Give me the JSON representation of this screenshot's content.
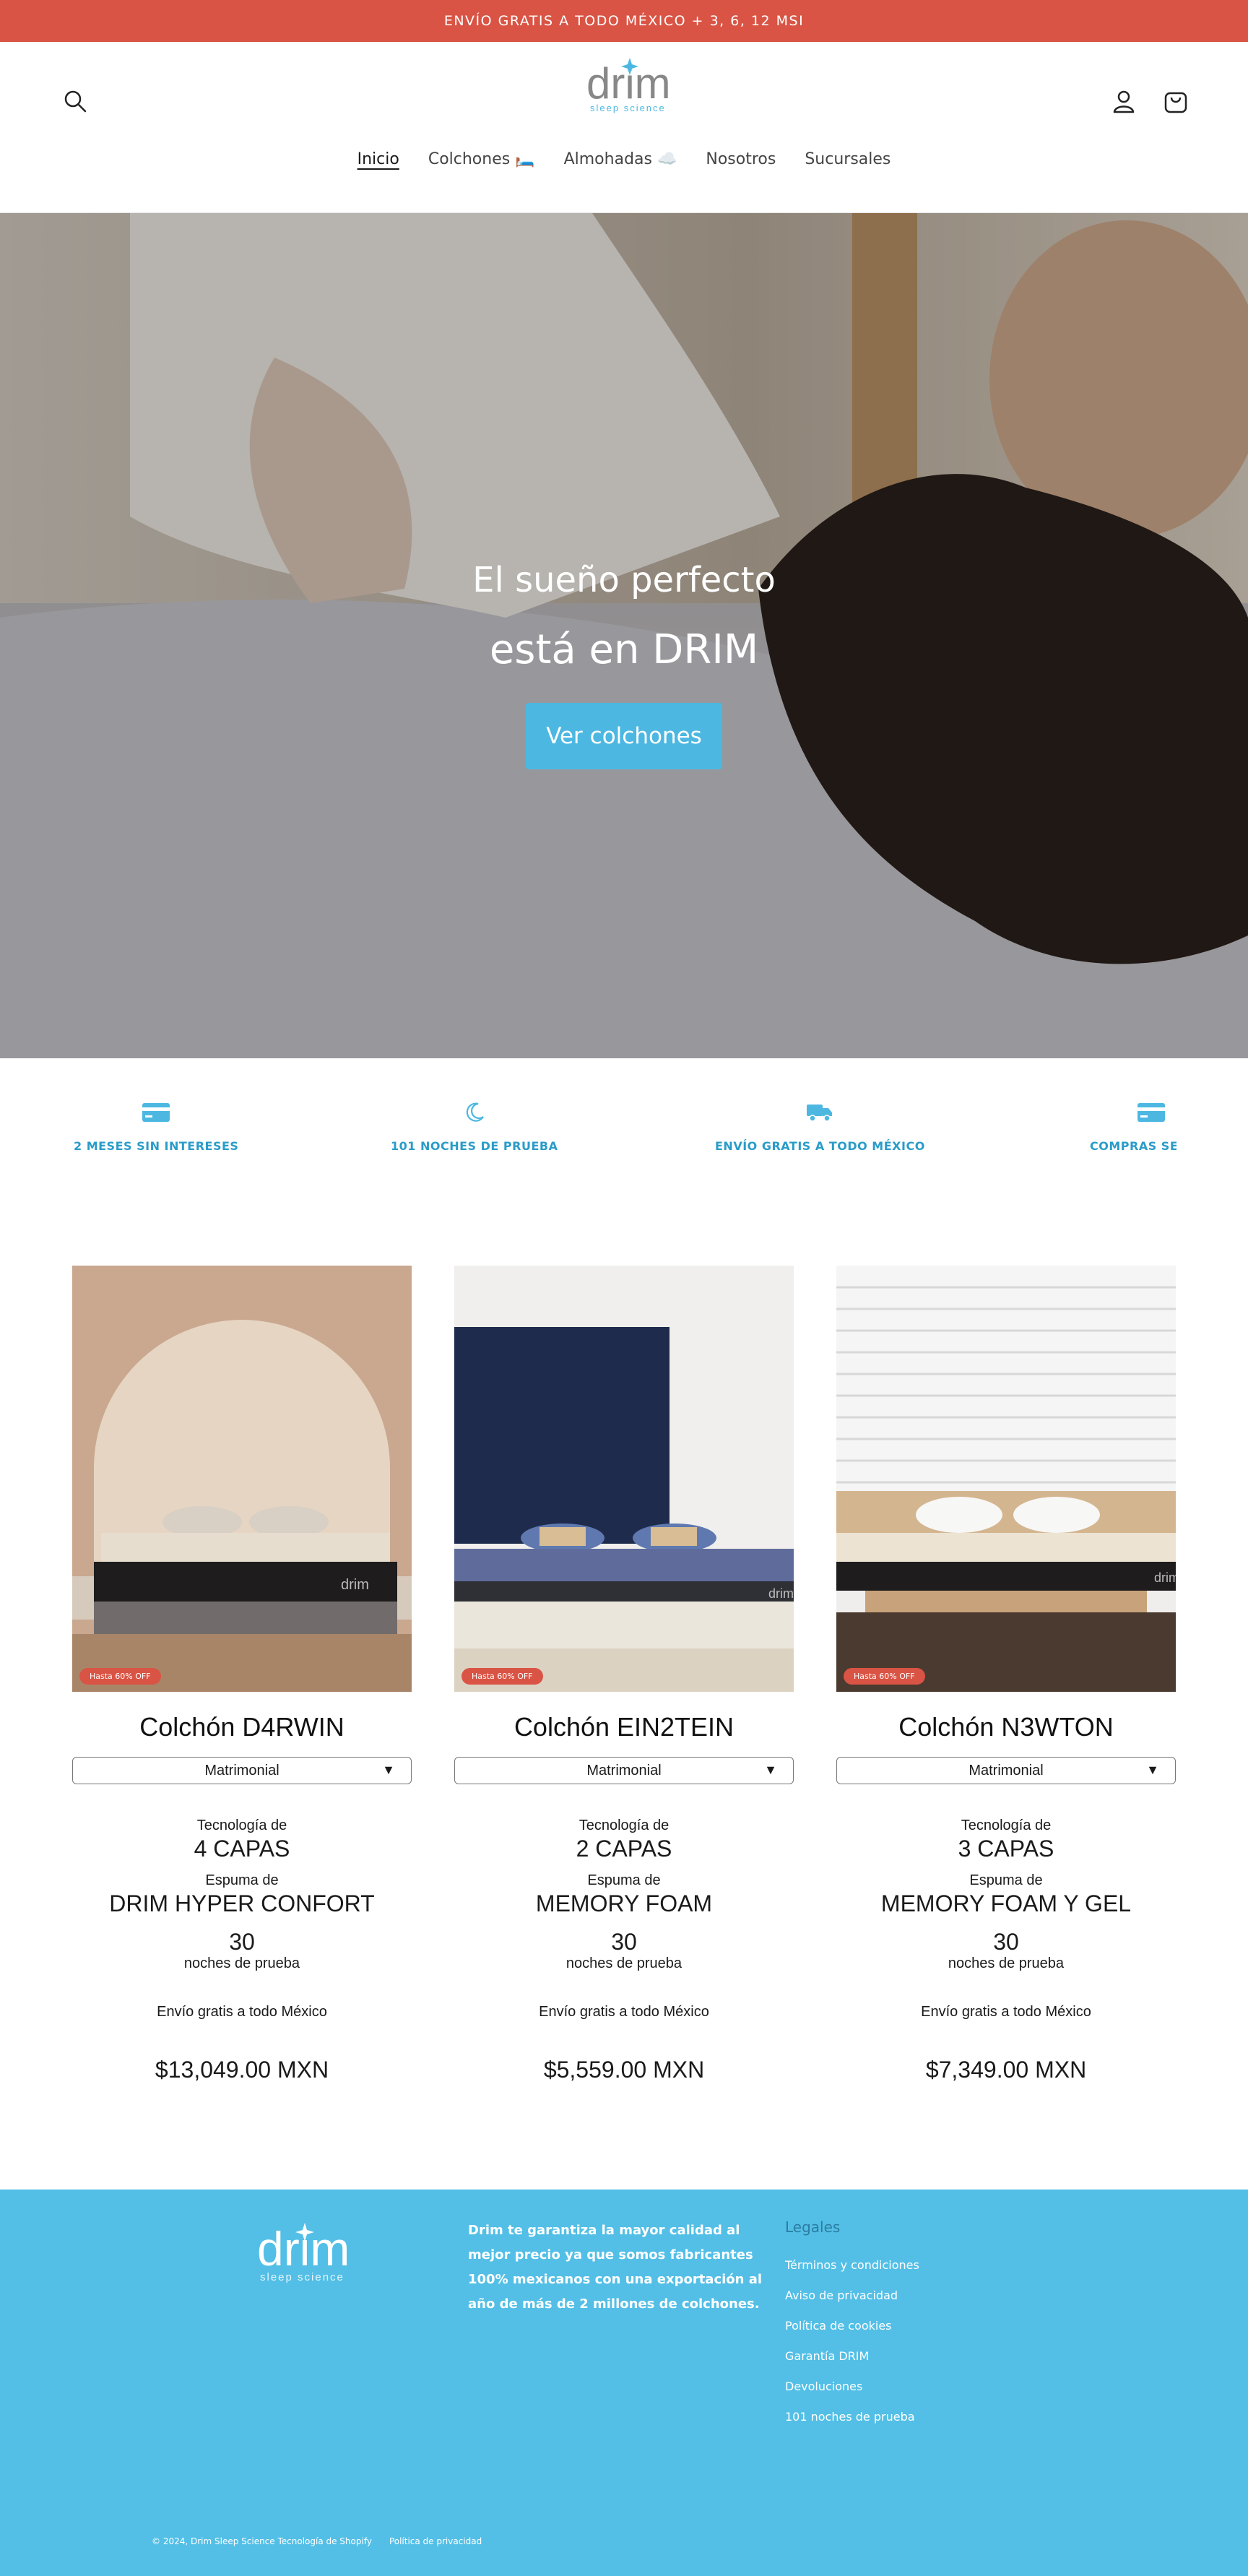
{
  "announcement": "ENVÍO GRATIS A TODO MÉXICO + 3, 6, 12 MSI",
  "header": {
    "logo_text": "drim",
    "logo_sub": "sleep science",
    "nav": [
      "Inicio",
      "Colchones 🛏️",
      "Almohadas ☁️",
      "Nosotros",
      "Sucursales"
    ]
  },
  "hero": {
    "line1": "El sueño perfecto",
    "line2": "está en DRIM",
    "button": "Ver colchones"
  },
  "benefits": [
    {
      "icon": "card-icon",
      "label": "2 MESES SIN INTERESES"
    },
    {
      "icon": "moon-icon",
      "label": "101 NOCHES DE PRUEBA"
    },
    {
      "icon": "truck-icon",
      "label": "ENVÍO GRATIS A TODO MÉXICO"
    },
    {
      "icon": "card-icon",
      "label": "COMPRAS SEG"
    }
  ],
  "products": [
    {
      "name": "Colchón D4RWIN",
      "badge": "Hasta 60% OFF",
      "size": "Matrimonial",
      "tech_label": "Tecnología de",
      "tech_value": "4 CAPAS",
      "foam_label": "Espuma de",
      "foam_value": "DRIM HYPER CONFORT",
      "nights": "30",
      "nights_label": "noches de prueba",
      "shipping": "Envío gratis a todo México",
      "price": "$13,049.00 MXN"
    },
    {
      "name": "Colchón EIN2TEIN",
      "badge": "Hasta 60% OFF",
      "size": "Matrimonial",
      "tech_label": "Tecnología de",
      "tech_value": "2 CAPAS",
      "foam_label": "Espuma de",
      "foam_value": "MEMORY FOAM",
      "nights": "30",
      "nights_label": "noches de prueba",
      "shipping": "Envío gratis a todo México",
      "price": "$5,559.00 MXN"
    },
    {
      "name": "Colchón N3WTON",
      "badge": "Hasta 60% OFF",
      "size": "Matrimonial",
      "tech_label": "Tecnología de",
      "tech_value": "3 CAPAS",
      "foam_label": "Espuma de",
      "foam_value": "MEMORY FOAM Y GEL",
      "nights": "30",
      "nights_label": "noches de prueba",
      "shipping": "Envío gratis a todo México",
      "price": "$7,349.00 MXN"
    }
  ],
  "footer": {
    "logo_text": "drim",
    "logo_sub": "sleep science",
    "about": "Drim te garantiza la mayor calidad al mejor precio ya que somos fabricantes 100% mexicanos con una exportación al año de más de 2 millones de colchones.",
    "legal_title": "Legales",
    "legal_links": [
      "Términos y condiciones",
      "Aviso de privacidad",
      "Política de cookies",
      "Garantía DRIM",
      "Devoluciones",
      "101 noches de prueba"
    ],
    "copyright": "© 2024, Drim Sleep Science Tecnología de Shopify",
    "privacy": "Política de privacidad"
  },
  "colors": {
    "accent": "#4cb8e2",
    "announce": "#d95444",
    "footer": "#53bfe6",
    "benefit_text": "#2a9cc8"
  }
}
